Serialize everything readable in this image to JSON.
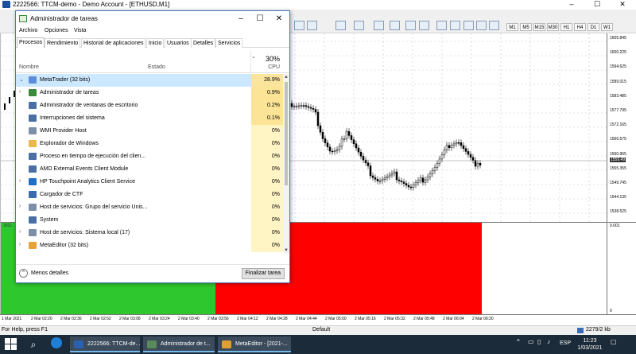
{
  "app": {
    "title": "2222566: TTCM-demo - Demo Account - [ETHUSD,M1]",
    "timeframes": [
      "M1",
      "M5",
      "M15",
      "M30",
      "H1",
      "H4",
      "D1",
      "W1"
    ]
  },
  "chart": {
    "prices": [
      "1605.845",
      "1600.225",
      "1594.625",
      "1589.015",
      "1583.485",
      "1577.795",
      "1572.165",
      "1566.575",
      "1560.965",
      "1555.355",
      "1549.745",
      "1544.135",
      "1538.525"
    ],
    "current_price": "1559.49",
    "indicator_top": "0.001",
    "indicator_bottom": "0",
    "indicator_label": "2021",
    "times": [
      "1 Mar 2021",
      "2 Mar 02:20",
      "2 Mar 02:36",
      "2 Mar 02:52",
      "2 Mar 03:08",
      "2 Mar 03:24",
      "2 Mar 03:40",
      "2 Mar 03:56",
      "2 Mar 04:12",
      "2 Mar 04:28",
      "2 Mar 04:44",
      "2 Mar 05:00",
      "2 Mar 05:16",
      "2 Mar 05:32",
      "2 Mar 05:48",
      "2 Mar 06:04",
      "2 Mar 06:20"
    ],
    "colors": {
      "bull": "#000000",
      "bear": "#000000",
      "green_zone": "#2ec72e",
      "red_zone": "#ff0000"
    }
  },
  "status": {
    "help": "For Help, press F1",
    "profile": "Default",
    "traffic": "2279/2 kb"
  },
  "taskbar": {
    "apps": [
      {
        "label": "2222566: TTCM-de...",
        "icon": "mt-icon"
      },
      {
        "label": "Administrador de t...",
        "icon": "task-manager-icon"
      },
      {
        "label": "MetaEditor - [2021-...",
        "icon": "metaeditor-icon"
      }
    ],
    "language": "ESP",
    "time": "11:23",
    "date": "1/03/2021"
  },
  "task_manager": {
    "title": "Administrador de tareas",
    "menu": [
      "Archivo",
      "Opciones",
      "Vista"
    ],
    "tabs": [
      "Procesos",
      "Rendimiento",
      "Historial de aplicaciones",
      "Inicio",
      "Usuarios",
      "Detalles",
      "Servicios"
    ],
    "active_tab": "Procesos",
    "columns": {
      "name": "Nombre",
      "status": "Estado",
      "cpu_total": "30%",
      "cpu": "CPU"
    },
    "processes": [
      {
        "name": "MetaTrader (32 bits)",
        "cpu": "28.9%",
        "expand": "v",
        "icon_color": "#5b8dd9",
        "selected": true
      },
      {
        "name": "Administrador de tareas",
        "cpu": "0.9%",
        "expand": ">",
        "icon_color": "#3a8a3a"
      },
      {
        "name": "Administrador de ventanas de escritorio",
        "cpu": "0.2%",
        "expand": "",
        "icon_color": "#4a6fa5"
      },
      {
        "name": "Interrupciones del sistema",
        "cpu": "0.1%",
        "expand": "",
        "icon_color": "#4a6fa5"
      },
      {
        "name": "WMI Provider Host",
        "cpu": "0%",
        "expand": "",
        "icon_color": "#7d8fa8"
      },
      {
        "name": "Explorador de Windows",
        "cpu": "0%",
        "expand": "",
        "icon_color": "#e8b84a"
      },
      {
        "name": "Proceso en tiempo de ejecución del clien...",
        "cpu": "0%",
        "expand": "",
        "icon_color": "#4a6fa5"
      },
      {
        "name": "AMD External Events Client Module",
        "cpu": "0%",
        "expand": "",
        "icon_color": "#4a6fa5"
      },
      {
        "name": "HP Touchpoint Analytics Client Service",
        "cpu": "0%",
        "expand": ">",
        "icon_color": "#1f6fc5"
      },
      {
        "name": "Cargador de CTF",
        "cpu": "0%",
        "expand": "",
        "icon_color": "#3a6ab0"
      },
      {
        "name": "Host de servicios: Grupo del servicio Unis...",
        "cpu": "0%",
        "expand": ">",
        "icon_color": "#7d8fa8"
      },
      {
        "name": "System",
        "cpu": "0%",
        "expand": "",
        "icon_color": "#4a6fa5"
      },
      {
        "name": "Host de servicios: Sistema local (17)",
        "cpu": "0%",
        "expand": ">",
        "icon_color": "#7d8fa8"
      },
      {
        "name": "MetaEditor (32 bits)",
        "cpu": "0%",
        "expand": ">",
        "icon_color": "#e8a23a"
      }
    ],
    "fewer_details": "Menos detalles",
    "end_task": "Finalizar tarea"
  }
}
